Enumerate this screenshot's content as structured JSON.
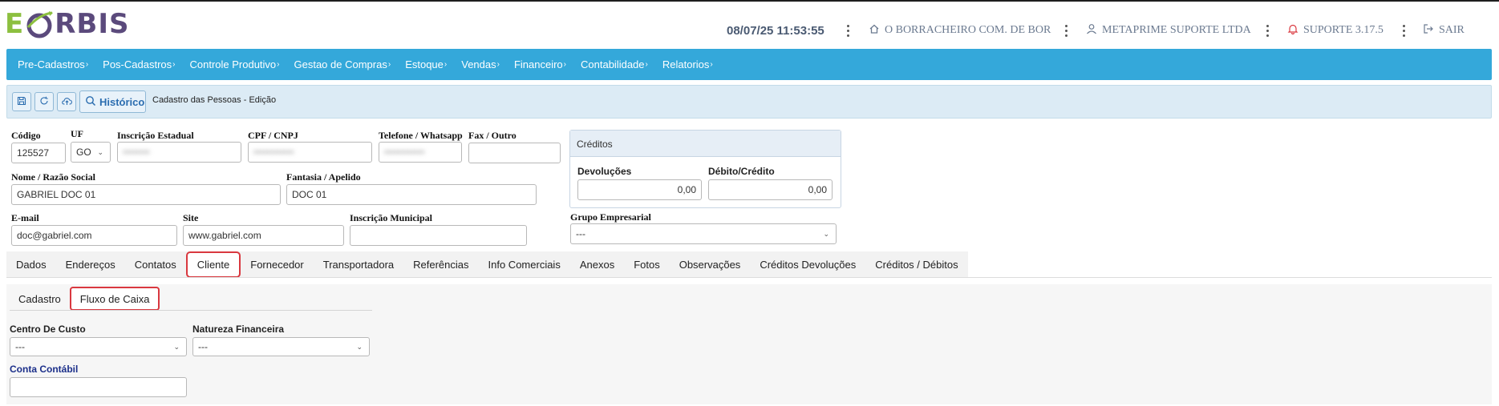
{
  "app": {
    "logo_e": "E",
    "logo_rest": "RBIS"
  },
  "header": {
    "datetime": "08/07/25 11:53:55",
    "company": "O BORRACHEIRO COM. DE BOR",
    "user": "METAPRIME SUPORTE LTDA",
    "support": "SUPORTE 3.17.5",
    "logout": "SAIR"
  },
  "nav": [
    {
      "label": "Pre-Cadastros"
    },
    {
      "label": "Pos-Cadastros"
    },
    {
      "label": "Controle Produtivo"
    },
    {
      "label": "Gestao de Compras"
    },
    {
      "label": "Estoque"
    },
    {
      "label": "Vendas"
    },
    {
      "label": "Financeiro"
    },
    {
      "label": "Contabilidade"
    },
    {
      "label": "Relatorios"
    }
  ],
  "toolbar": {
    "history_label": "Histórico",
    "title": "Cadastro das Pessoas - Edição"
  },
  "form": {
    "codigo": {
      "label": "Código",
      "value": "125527"
    },
    "uf": {
      "label": "UF",
      "value": "GO"
    },
    "ie": {
      "label": "Inscrição Estadual",
      "value": "••••••••"
    },
    "cpf": {
      "label": "CPF / CNPJ",
      "value": "••••••••••••"
    },
    "telefone": {
      "label": "Telefone / Whatsapp",
      "value": "••••••••••••"
    },
    "fax": {
      "label": "Fax / Outro",
      "value": ""
    },
    "nome": {
      "label": "Nome / Razão Social",
      "value": "GABRIEL DOC 01"
    },
    "fantasia": {
      "label": "Fantasia / Apelido",
      "value": "DOC 01"
    },
    "email": {
      "label": "E-mail",
      "value": "doc@gabriel.com"
    },
    "site": {
      "label": "Site",
      "value": "www.gabriel.com"
    },
    "im": {
      "label": "Inscrição Municipal",
      "value": ""
    },
    "grupo": {
      "label": "Grupo Empresarial",
      "value": "---"
    }
  },
  "creditos": {
    "title": "Créditos",
    "devolucoes": {
      "label": "Devoluções",
      "value": "0,00"
    },
    "debito": {
      "label": "Débito/Crédito",
      "value": "0,00"
    }
  },
  "tabs": [
    {
      "label": "Dados"
    },
    {
      "label": "Endereços"
    },
    {
      "label": "Contatos"
    },
    {
      "label": "Cliente"
    },
    {
      "label": "Fornecedor"
    },
    {
      "label": "Transportadora"
    },
    {
      "label": "Referências"
    },
    {
      "label": "Info Comerciais"
    },
    {
      "label": "Anexos"
    },
    {
      "label": "Fotos"
    },
    {
      "label": "Observações"
    },
    {
      "label": "Créditos Devoluções"
    },
    {
      "label": "Créditos / Débitos"
    }
  ],
  "subtabs": [
    {
      "label": "Cadastro"
    },
    {
      "label": "Fluxo de Caixa"
    }
  ],
  "cliente": {
    "centro": {
      "label": "Centro De Custo",
      "value": "---"
    },
    "natureza": {
      "label": "Natureza Financeira",
      "value": "---"
    },
    "conta": {
      "label": "Conta Contábil",
      "value": ""
    }
  },
  "colors": {
    "navbar": "#34a8da",
    "highlight": "#d9383f",
    "toolbar": "#dcebf5",
    "conta_label": "#1b2f8a"
  }
}
